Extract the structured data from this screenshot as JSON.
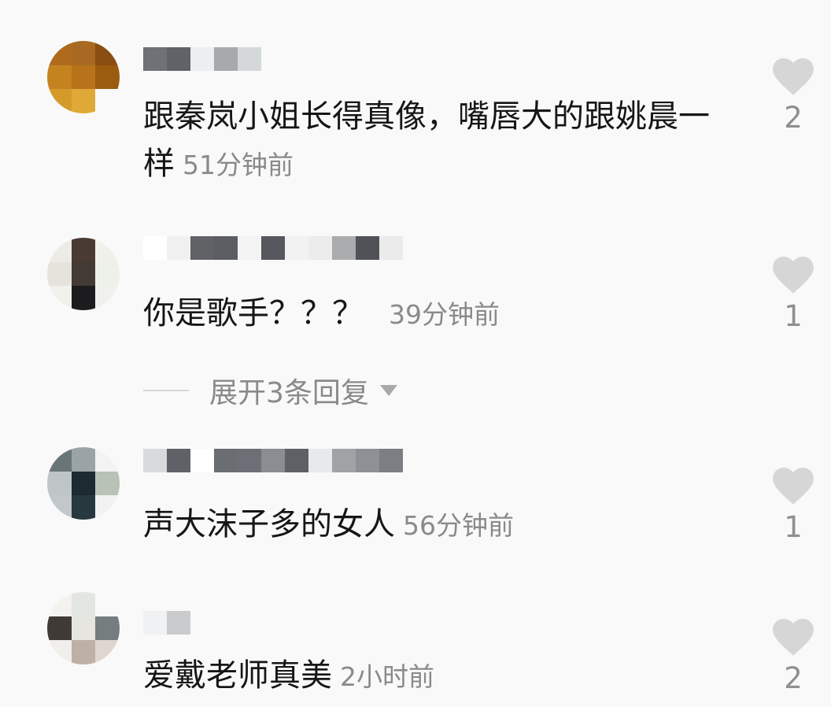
{
  "comments": [
    {
      "text": "跟秦岚小姐长得真像，嘴唇大的跟姚晨一样",
      "time": "51分钟前",
      "likes": "2",
      "avatar_colors": [
        "#b06a1c",
        "#a86a22",
        "#8a4e12",
        "#c58320",
        "#b8721a",
        "#9b5c10",
        "#d59b2a",
        "#e0a836",
        "#f9f9f9"
      ],
      "name_colors": [
        "#6e7176",
        "#5f6368",
        "#eceeef",
        "#a7a9ab",
        "#d5d8da"
      ]
    },
    {
      "text": "你是歌手？？？",
      "time": "39分钟前",
      "likes": "1",
      "avatar_colors": [
        "#ecebe6",
        "#4a3a34",
        "#f1f1ec",
        "#e6e3dd",
        "#433a35",
        "#eef0ea",
        "#f1f1ec",
        "#1c1c1e",
        "#f0f0ec"
      ],
      "name_colors": [
        "#ffffff",
        "#f0f0f0",
        "#606266",
        "#5b5e63",
        "#f3f3f3",
        "#55585c",
        "#f2f2f2",
        "#ececec",
        "#a9abad",
        "#4f5256",
        "#ebebeb"
      ]
    },
    {
      "text": "声大沫子多的女人",
      "time": "56分钟前",
      "likes": "1",
      "avatar_colors": [
        "#6a7578",
        "#9aa3a6",
        "#f3f3f3",
        "#bfc5c7",
        "#1c2a32",
        "#b8c2b5",
        "#c2c7c9",
        "#27383f",
        "#f2f2f2"
      ],
      "name_colors": [
        "#d8dadc",
        "#5e6166",
        "#ffffff",
        "#6a6d72",
        "#6c6f75",
        "#8a8d91",
        "#5d6064",
        "#e8e9ea",
        "#a0a3a6",
        "#8d9094",
        "#7b7e83"
      ]
    },
    {
      "text": "爱戴老师真美",
      "time": "2小时前",
      "likes": "2",
      "avatar_colors": [
        "#f3f2ee",
        "#e3e5e0",
        "#f9f9f9",
        "#3f3a36",
        "#e6e5df",
        "#767d7f",
        "#f0efec",
        "#bfb0a6",
        "#ded6cf"
      ],
      "name_colors": [
        "#f0f1f2",
        "#c9cbcd"
      ]
    }
  ],
  "replies_toggle": {
    "label": "展开3条回复"
  },
  "colors": {
    "heart": "#d6d6d6",
    "time": "#8a8a8a",
    "text": "#161616",
    "background": "#f9f9f9"
  }
}
